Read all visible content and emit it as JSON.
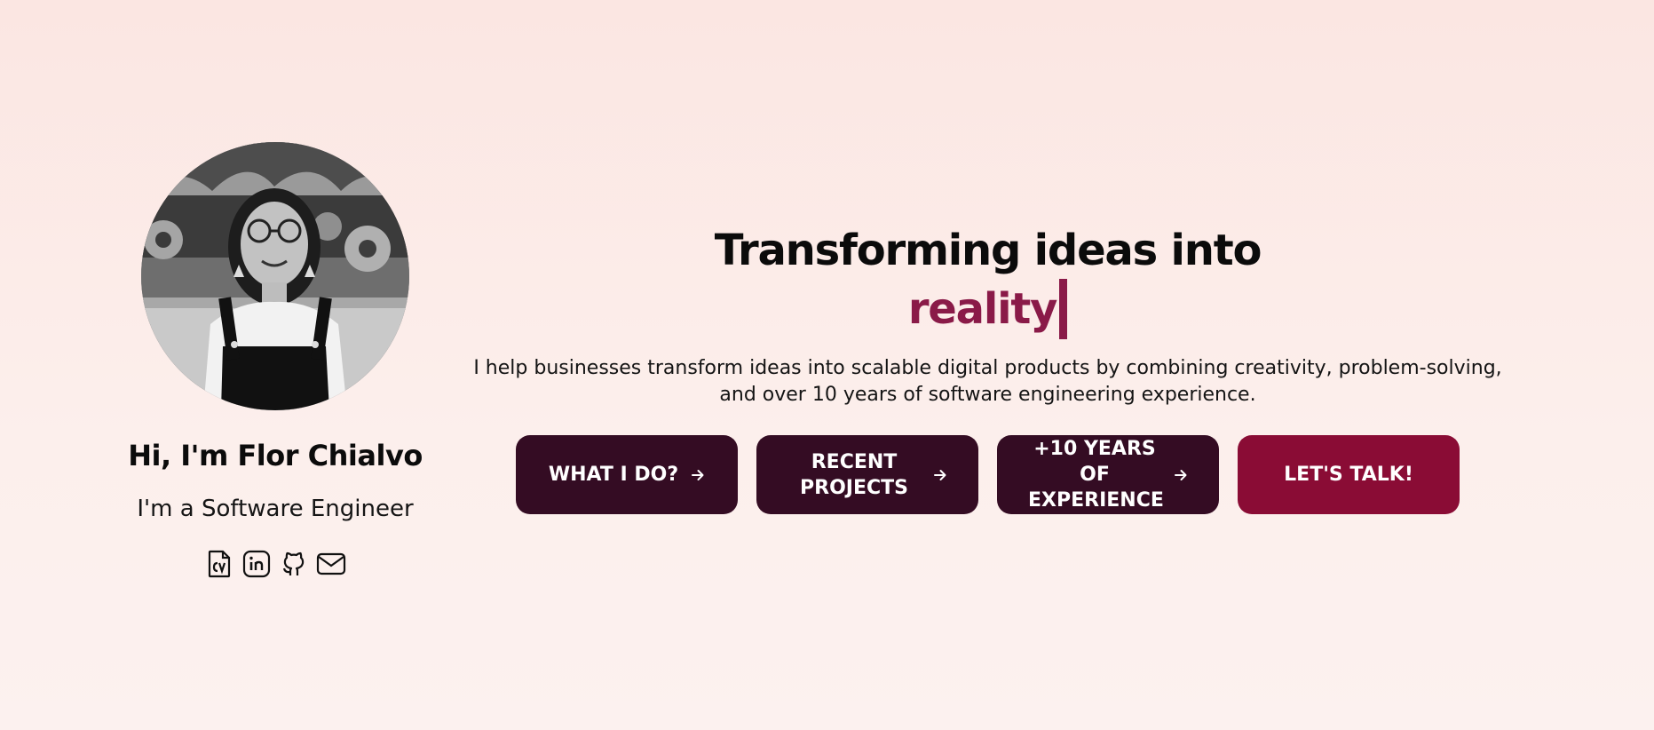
{
  "profile": {
    "greeting": "Hi, I'm Flor Chialvo",
    "role": "I'm a Software Engineer",
    "avatar_alt": "portrait-photo",
    "socials": [
      {
        "icon": "cv-icon"
      },
      {
        "icon": "linkedin-icon"
      },
      {
        "icon": "github-icon"
      },
      {
        "icon": "mail-icon"
      }
    ]
  },
  "hero": {
    "headline": "Transforming ideas into",
    "typed_word": "reality",
    "description": "I help businesses transform ideas into scalable digital products by combining creativity, problem-solving, and over 10 years of software engineering experience."
  },
  "actions": [
    {
      "label": "WHAT I DO?",
      "icon": "arrow-right-icon"
    },
    {
      "label": "RECENT PROJECTS",
      "icon": "arrow-right-icon"
    },
    {
      "label": "+10 YEARS OF EXPERIENCE",
      "icon": "arrow-right-icon"
    },
    {
      "label": "LET'S TALK!"
    }
  ],
  "colors": {
    "background": "#fbe9e5",
    "accent": "#8a1a48",
    "button_dark": "#340c23",
    "button_primary": "#8a0c35"
  }
}
